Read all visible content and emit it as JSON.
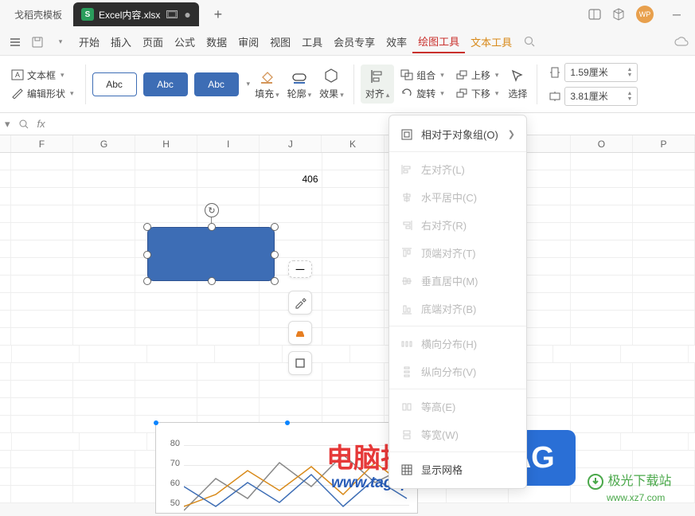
{
  "titlebar": {
    "inactive_tab": "戈稻壳模板",
    "active_tab": "Excel内容.xlsx",
    "avatar": "WP"
  },
  "menubar": {
    "items": [
      "开始",
      "插入",
      "页面",
      "公式",
      "数据",
      "审阅",
      "视图",
      "工具",
      "会员专享",
      "效率",
      "绘图工具",
      "文本工具"
    ]
  },
  "toolbar": {
    "textbox": "文本框",
    "editshape": "编辑形状",
    "preset_label": "Abc",
    "fill": "填充",
    "outline": "轮廓",
    "effect": "效果",
    "align": "对齐",
    "group": "组合",
    "rotate": "旋转",
    "up": "上移",
    "down": "下移",
    "select": "选择",
    "height": "1.59厘米",
    "width": "3.81厘米"
  },
  "formula_bar": {
    "fx": "fx"
  },
  "columns": [
    "",
    "F",
    "G",
    "H",
    "I",
    "J",
    "K",
    "",
    "",
    "",
    "O",
    "P",
    ""
  ],
  "cell_value": "406",
  "align_menu": {
    "header": "相对于对象组(O)",
    "items": [
      {
        "label": "左对齐(L)",
        "enabled": false
      },
      {
        "label": "水平居中(C)",
        "enabled": false
      },
      {
        "label": "右对齐(R)",
        "enabled": false
      },
      {
        "label": "顶端对齐(T)",
        "enabled": false
      },
      {
        "label": "垂直居中(M)",
        "enabled": false
      },
      {
        "label": "底端对齐(B)",
        "enabled": false
      },
      {
        "label": "横向分布(H)",
        "enabled": false
      },
      {
        "label": "纵向分布(V)",
        "enabled": false
      },
      {
        "label": "等高(E)",
        "enabled": false
      },
      {
        "label": "等宽(W)",
        "enabled": false
      },
      {
        "label": "显示网格",
        "enabled": true
      }
    ]
  },
  "chart_data": {
    "type": "line",
    "y_ticks": [
      80,
      70,
      60,
      50
    ],
    "ylim": [
      0,
      90
    ],
    "series_count": 3
  },
  "watermarks": {
    "title": "电脑技术网",
    "url": "www.tagxp.com",
    "tag": "TAG",
    "site_name": "极光下载站",
    "site_url": "www.xz7.com"
  }
}
